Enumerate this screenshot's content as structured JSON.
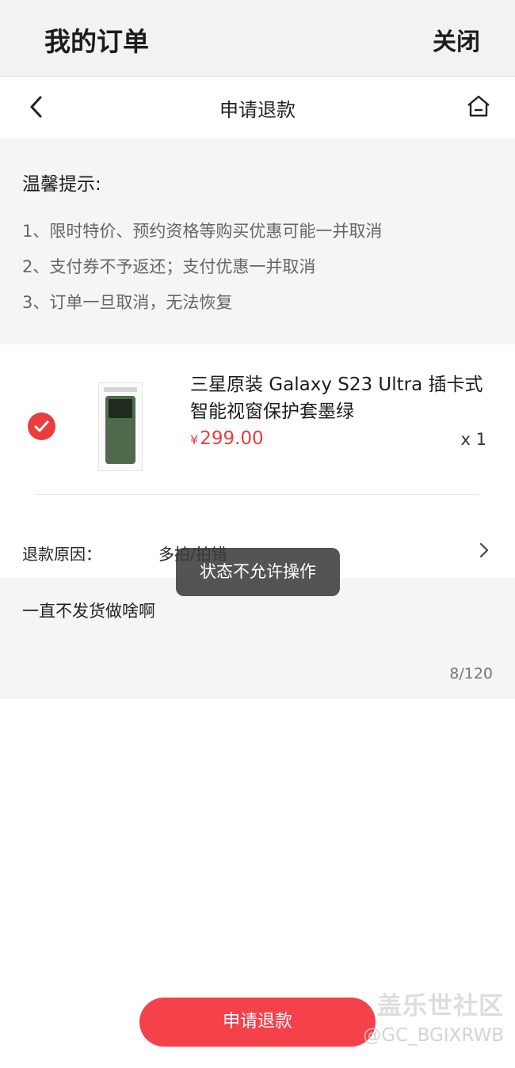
{
  "topbar": {
    "title": "我的订单",
    "close_label": "关闭"
  },
  "navbar": {
    "title": "申请退款",
    "back_icon": "chevron-left-icon",
    "home_icon": "home-icon"
  },
  "tips": {
    "heading": "温馨提示:",
    "lines": [
      "1、限时特价、预约资格等购买优惠可能一并取消",
      "2、支付券不予返还；支付优惠一并取消",
      "3、订单一旦取消，无法恢复"
    ]
  },
  "product": {
    "checked": true,
    "name": "三星原装 Galaxy S23 Ultra 插卡式智能视窗保护套墨绿",
    "currency": "¥",
    "price": "299.00",
    "quantity": "x 1",
    "price_color": "#ea3d3f"
  },
  "refund_reason": {
    "label": "退款原因：",
    "value": "多拍/拍错"
  },
  "description": {
    "text": "一直不发货做啥啊",
    "count": "8/120"
  },
  "toast": {
    "message": "状态不允许操作"
  },
  "submit": {
    "label": "申请退款",
    "color": "#f5414a"
  },
  "watermark": {
    "line1": "盖乐世社区",
    "line2": "@GC_BGIXRWB"
  }
}
